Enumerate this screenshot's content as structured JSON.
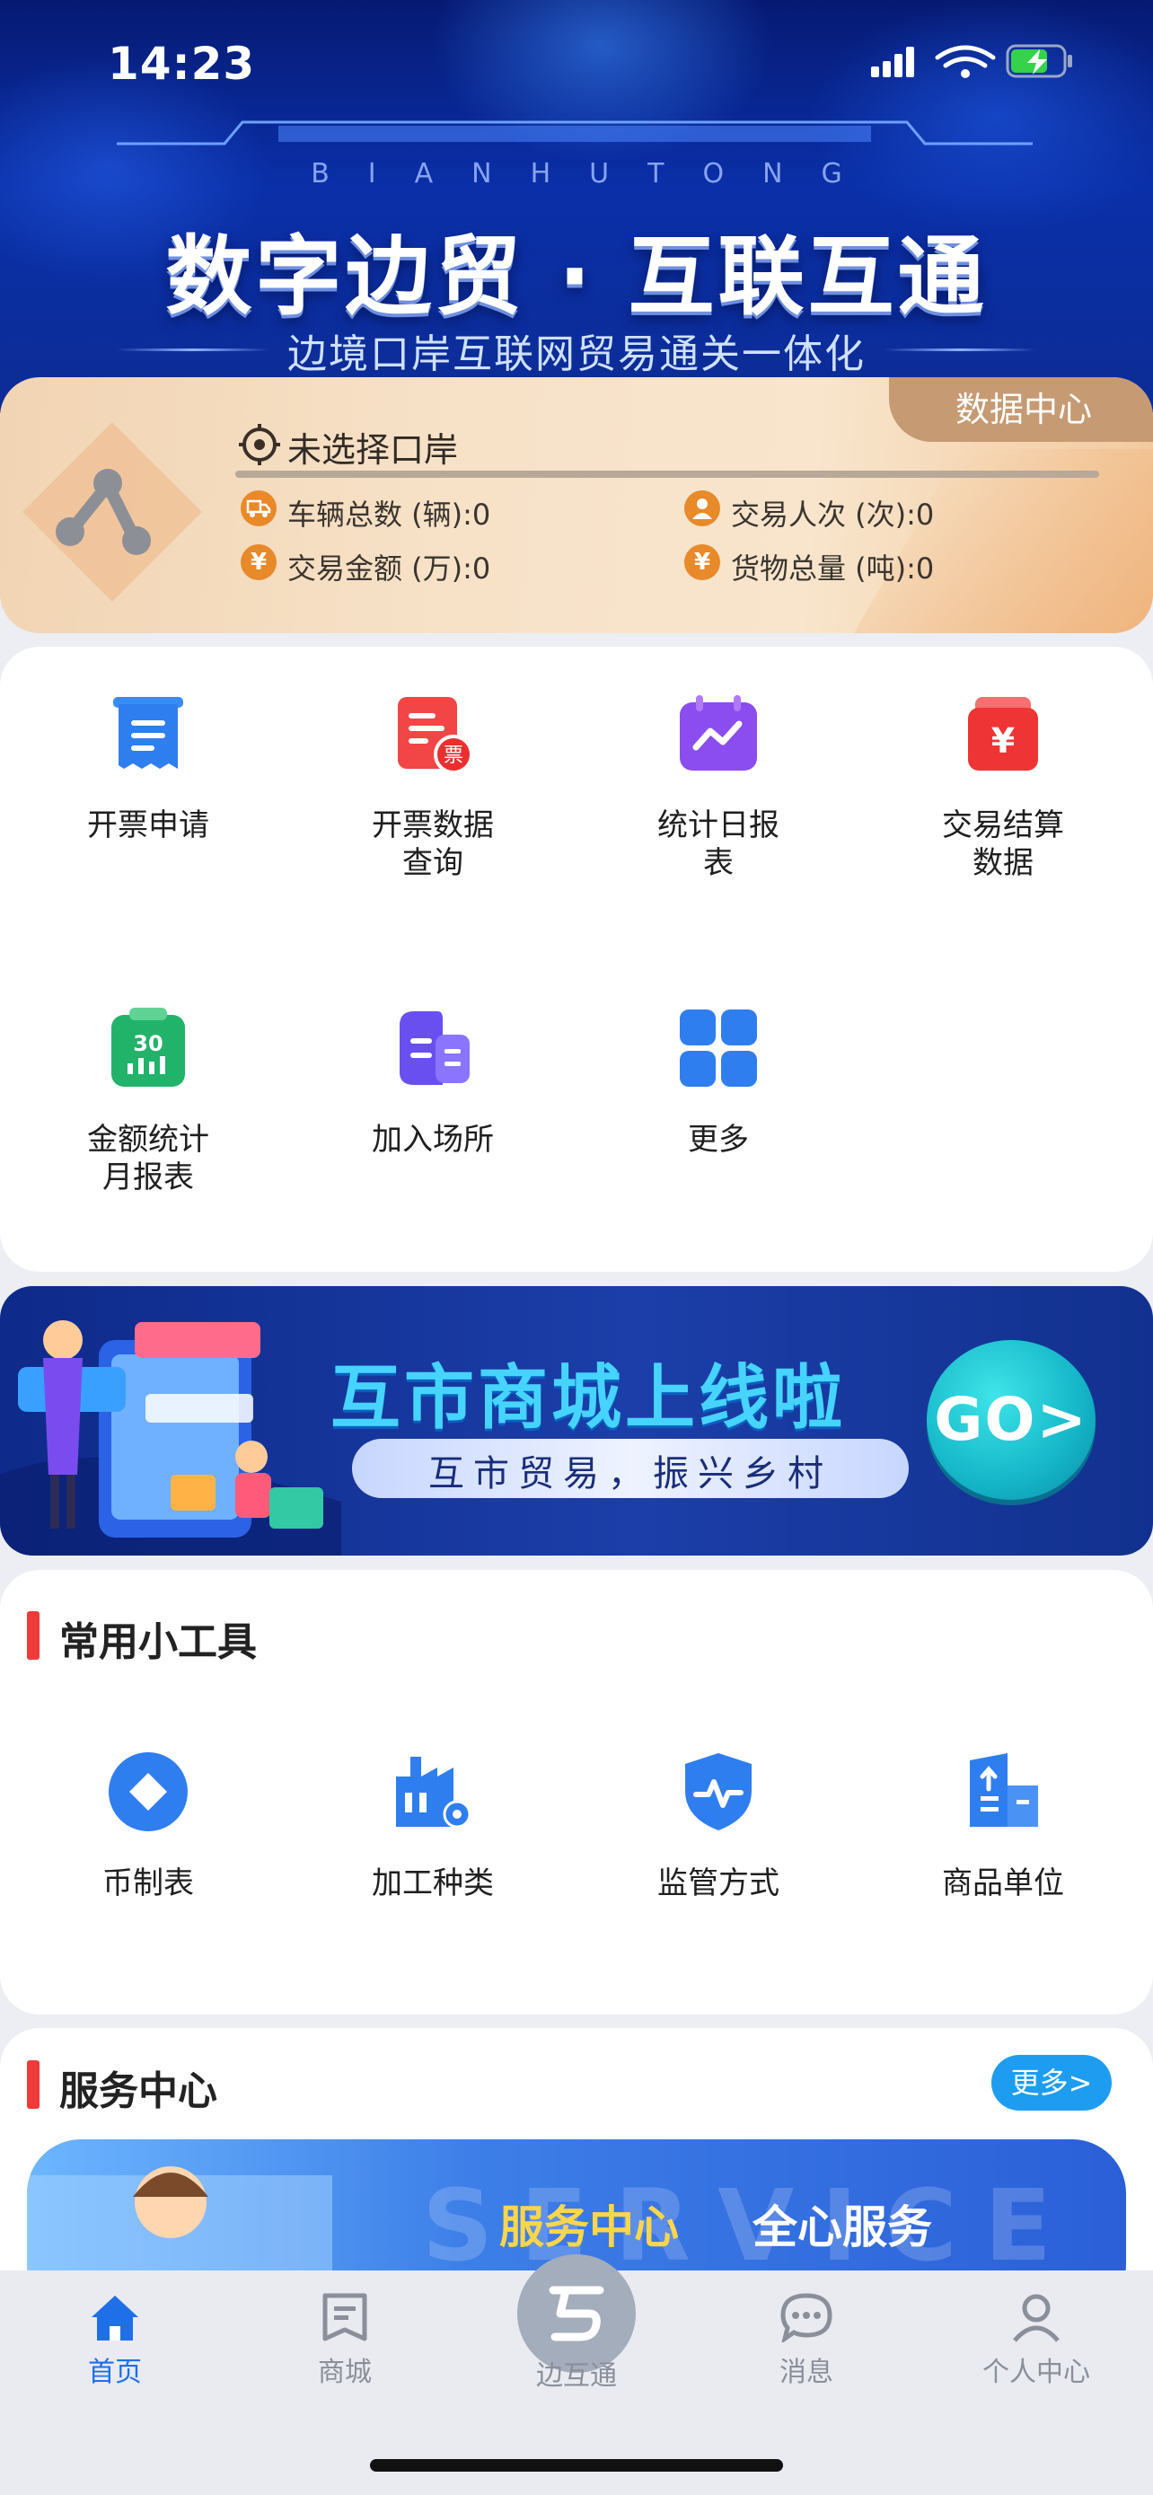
{
  "status_bar": {
    "time": "14:23"
  },
  "hero": {
    "pinyin": "BIANHUTONG",
    "title": "数字边贸 · 互联互通",
    "subtitle": "边境口岸互联网贸易通关一体化"
  },
  "data_card": {
    "tag": "数据中心",
    "location": "未选择口岸",
    "stats": [
      {
        "label": "车辆总数 (辆):0"
      },
      {
        "label": "交易人次 (次):0"
      },
      {
        "label": "交易金额 (万):0"
      },
      {
        "label": "货物总量 (吨):0"
      }
    ]
  },
  "services": {
    "items": [
      {
        "label": "开票申请",
        "icon": "invoice-icon"
      },
      {
        "label": "开票数据\n查询",
        "icon": "invoice-query-icon"
      },
      {
        "label": "统计日报\n表",
        "icon": "daily-report-icon"
      },
      {
        "label": "交易结算\n数据",
        "icon": "settlement-icon"
      },
      {
        "label": "金额统计\n月报表",
        "icon": "monthly-report-icon"
      },
      {
        "label": "加入场所",
        "icon": "join-venue-icon"
      },
      {
        "label": "更多",
        "icon": "more-grid-icon"
      }
    ]
  },
  "banner": {
    "title": "互市商城上线啦",
    "subtitle": "互市贸易，振兴乡村",
    "go": "GO>"
  },
  "tools": {
    "title": "常用小工具",
    "items": [
      {
        "label": "币制表",
        "icon": "currency-icon"
      },
      {
        "label": "加工种类",
        "icon": "factory-icon"
      },
      {
        "label": "监管方式",
        "icon": "shield-pulse-icon"
      },
      {
        "label": "商品单位",
        "icon": "building-icon"
      }
    ]
  },
  "service_center": {
    "title": "服务中心",
    "more": "更多>",
    "banner_watermark": "SERVICE",
    "banner_title": "服务中心",
    "banner_slogan": "全心服务"
  },
  "tabbar": {
    "items": [
      {
        "label": "首页",
        "active": true
      },
      {
        "label": "商城"
      },
      {
        "label": "边互通"
      },
      {
        "label": "消息"
      },
      {
        "label": "个人中心"
      }
    ]
  },
  "colors": {
    "primary": "#1e6fe8",
    "accent_red": "#f03a3a",
    "orange": "#e8892a"
  }
}
